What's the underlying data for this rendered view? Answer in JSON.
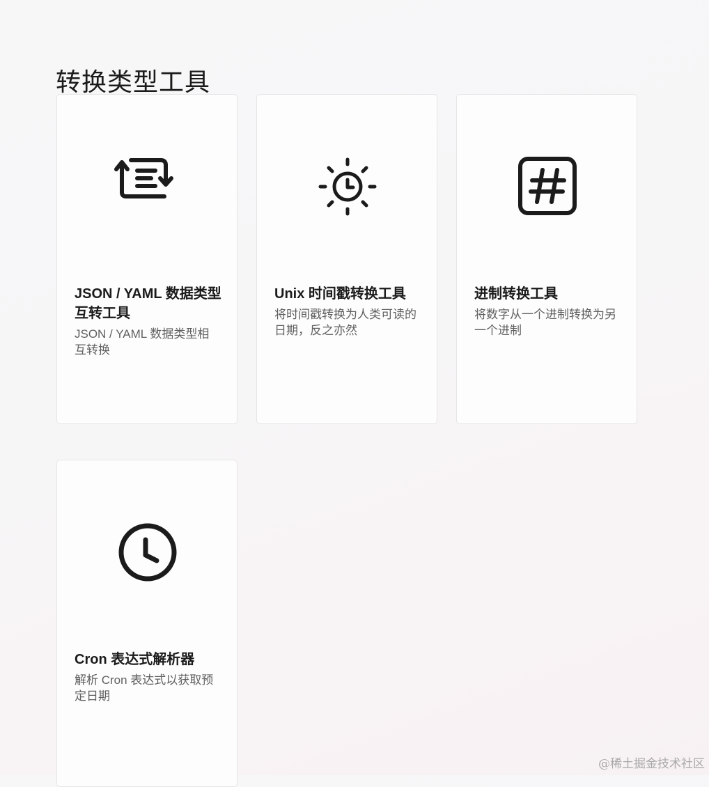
{
  "page": {
    "title": "转换类型工具"
  },
  "cards": [
    {
      "title": "JSON / YAML 数据类型互转工具",
      "description": "JSON / YAML 数据类型相互转换",
      "icon": "json-yaml-convert-icon"
    },
    {
      "title": "Unix 时间戳转换工具",
      "description": "将时间戳转换为人类可读的日期，反之亦然",
      "icon": "timestamp-sun-clock-icon"
    },
    {
      "title": "进制转换工具",
      "description": "将数字从一个进制转换为另一个进制",
      "icon": "hash-icon"
    },
    {
      "title": "Cron 表达式解析器",
      "description": "解析 Cron 表达式以获取预定日期",
      "icon": "clock-icon"
    }
  ],
  "watermark": "@稀土掘金技术社区",
  "colors": {
    "icon": "#1b1b1b",
    "card_background": "#fdfdfd",
    "card_border": "#e6e6e6",
    "description_text": "#5f5f5f"
  }
}
